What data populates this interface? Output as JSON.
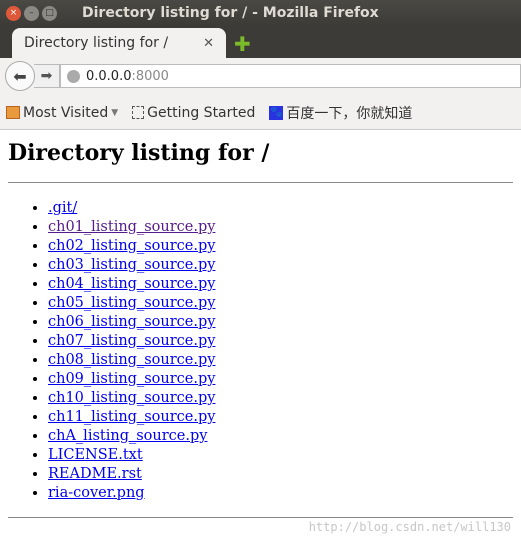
{
  "window": {
    "title": "Directory listing for / - Mozilla Firefox"
  },
  "tab": {
    "label": "Directory listing for /"
  },
  "address": {
    "host": "0.0.0.0",
    "port": ":8000"
  },
  "bookmarks": [
    {
      "label": "Most Visited",
      "icon": "folder-icon"
    },
    {
      "label": "Getting Started",
      "icon": "page-icon"
    },
    {
      "label": "百度一下，你就知道",
      "icon": "baidu-paw-icon"
    }
  ],
  "page": {
    "heading": "Directory listing for /",
    "files": [
      ".git/",
      "ch01_listing_source.py",
      "ch02_listing_source.py",
      "ch03_listing_source.py",
      "ch04_listing_source.py",
      "ch05_listing_source.py",
      "ch06_listing_source.py",
      "ch07_listing_source.py",
      "ch08_listing_source.py",
      "ch09_listing_source.py",
      "ch10_listing_source.py",
      "ch11_listing_source.py",
      "chA_listing_source.py",
      "LICENSE.txt",
      "README.rst",
      "ria-cover.png"
    ],
    "visited": [
      1
    ]
  },
  "watermark": "http://blog.csdn.net/will130",
  "colors": {
    "link": "#0000ee",
    "visited": "#551a8b",
    "titlebar": "#3c3b37"
  }
}
